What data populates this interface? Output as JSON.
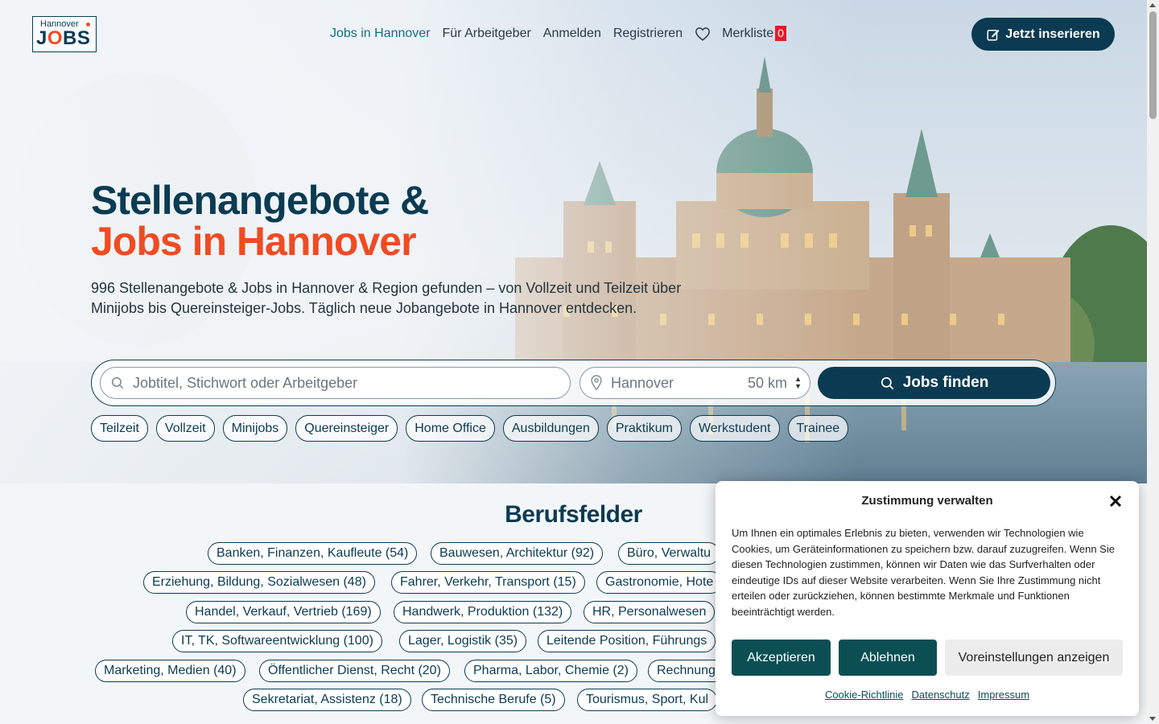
{
  "header": {
    "logo_top": "Hannover",
    "logo_main_a": "J",
    "logo_main_o": "O",
    "logo_main_b": "BS",
    "nav": [
      "Jobs in Hannover",
      "Für Arbeitgeber",
      "Anmelden",
      "Registrieren"
    ],
    "merkliste_label": "Merkliste",
    "merkliste_count": "0",
    "cta_label": "Jetzt inserieren"
  },
  "hero": {
    "title_line1": "Stellenangebote &",
    "title_line2": "Jobs in Hannover",
    "intro": "996 Stellenangebote & Jobs in Hannover & Region gefunden – von Vollzeit und Teilzeit über Minijobs bis Quereinsteiger-Jobs. Täglich neue Jobangebote in Hannover entdecken.",
    "search_placeholder": "Jobtitel, Stichwort oder Arbeitgeber",
    "location_placeholder": "Hannover",
    "radius": "50 km",
    "search_button": "Jobs finden",
    "chips": [
      "Teilzeit",
      "Vollzeit",
      "Minijobs",
      "Quereinsteiger",
      "Home Office",
      "Ausbildungen",
      "Praktikum",
      "Werkstudent",
      "Trainee"
    ]
  },
  "berufsfelder": {
    "title": "Berufsfelder",
    "items": [
      "Banken, Finanzen, Kaufleute (54)",
      "Bauwesen, Architektur (92)",
      "Büro, Verwaltu",
      "Erziehung, Bildung, Sozialwesen (48)",
      "Fahrer, Verkehr, Transport (15)",
      "Gastronomie, Hote",
      "Handel, Verkauf, Vertrieb (169)",
      "Handwerk, Produktion (132)",
      "HR, Personalwesen",
      "IT, TK, Softwareentwicklung (100)",
      "Lager, Logistik (35)",
      "Leitende Position, Führungs",
      "Marketing, Medien (40)",
      "Öffentlicher Dienst, Recht (20)",
      "Pharma, Labor, Chemie (2)",
      "Rechnung",
      "Sekretariat, Assistenz (18)",
      "Technische Berufe (5)",
      "Tourismus, Sport, Kul"
    ]
  },
  "consent": {
    "title": "Zustimmung verwalten",
    "body": "Um Ihnen ein optimales Erlebnis zu bieten, verwenden wir Technologien wie Cookies, um Geräteinformationen zu speichern bzw. darauf zuzugreifen. Wenn Sie diesen Technologien zustimmen, können wir Daten wie das Surfverhalten oder eindeutige IDs auf dieser Website verarbeiten. Wenn Sie Ihre Zustimmung nicht erteilen oder zurückziehen, können bestimmte Merkmale und Funktionen beeinträchtigt werden.",
    "accept": "Akzeptieren",
    "decline": "Ablehnen",
    "preferences": "Voreinstellungen anzeigen",
    "links": [
      "Cookie-Richtlinie",
      "Datenschutz",
      "Impressum"
    ]
  },
  "colors": {
    "brand_dark": "#0b3b52",
    "brand_orange": "#f04b23",
    "consent_button": "#0b4f53",
    "badge_red": "#e11d2a"
  }
}
